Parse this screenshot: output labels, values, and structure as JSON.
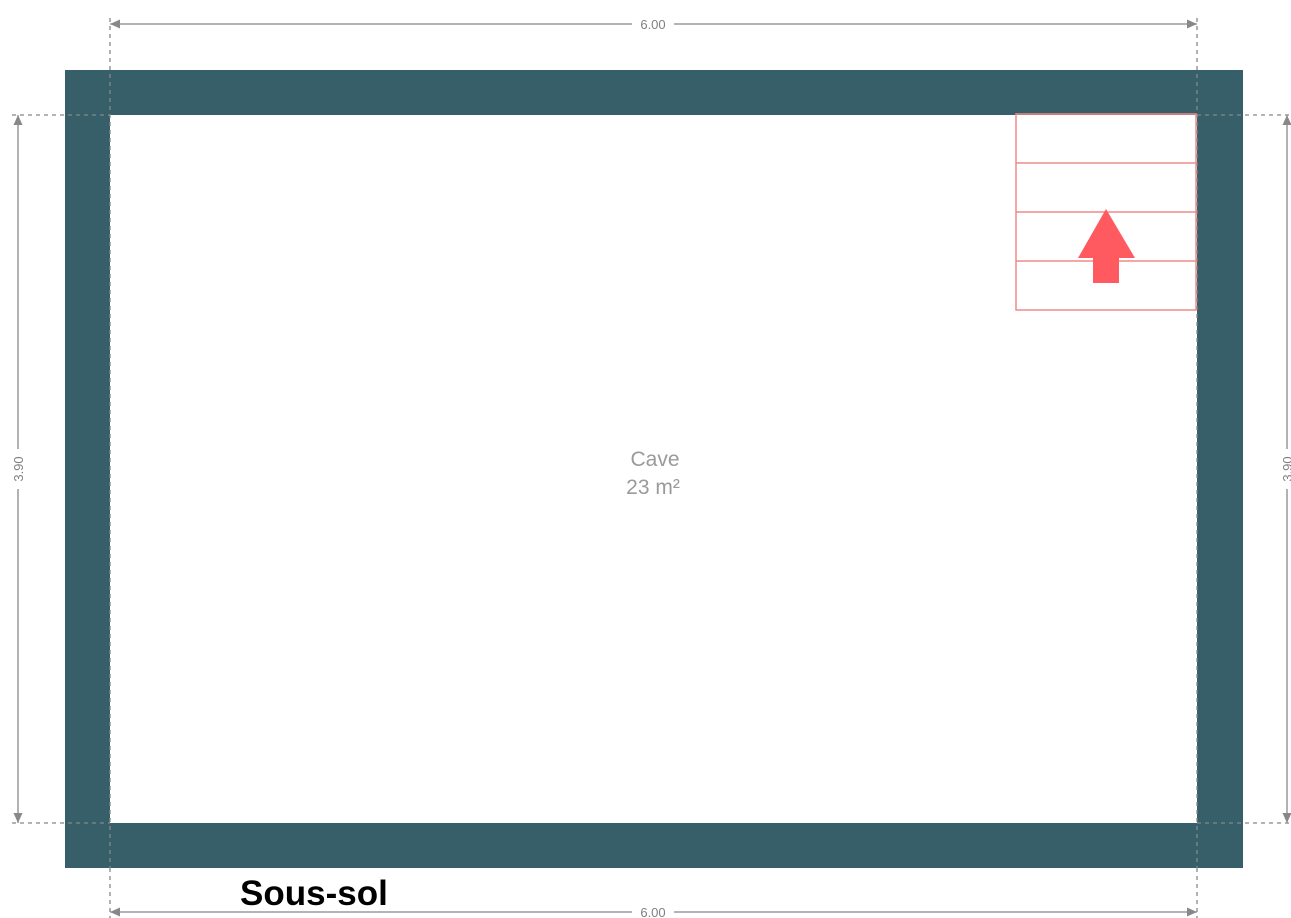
{
  "floor": {
    "name": "Sous-sol"
  },
  "room": {
    "name": "Cave",
    "area": "23 m²"
  },
  "dimensions": {
    "top_width": "6.00",
    "bottom_width": "6.00",
    "left_height": "3.90",
    "right_height": "3.90"
  },
  "stairs": {
    "steps": 4,
    "direction": "up"
  },
  "colors": {
    "wall": "#365f69",
    "stair_line": "#f08a8a",
    "stair_arrow": "#ff5a5f",
    "dimension_line": "#888888",
    "room_text": "#9a9a9a"
  }
}
